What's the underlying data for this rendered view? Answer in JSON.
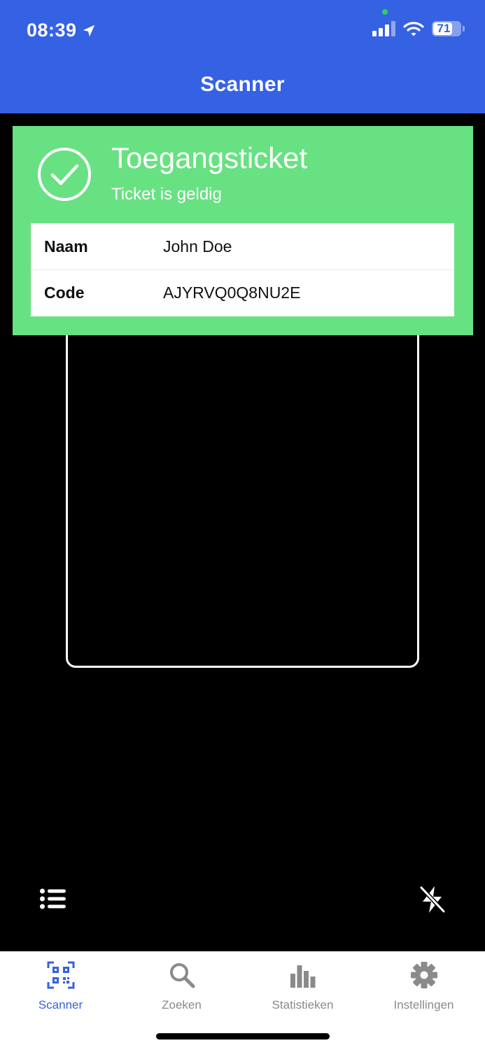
{
  "status_bar": {
    "time": "08:39",
    "battery": "71",
    "battery_level": 0.71
  },
  "nav": {
    "title": "Scanner"
  },
  "result": {
    "title": "Toegangsticket",
    "subtitle": "Ticket is geldig",
    "rows": [
      {
        "label": "Naam",
        "value": "John Doe"
      },
      {
        "label": "Code",
        "value": "AJYRVQ0Q8NU2E"
      }
    ]
  },
  "tabs": [
    {
      "label": "Scanner",
      "icon": "qr-code-icon",
      "active": true
    },
    {
      "label": "Zoeken",
      "icon": "search-icon",
      "active": false
    },
    {
      "label": "Statistieken",
      "icon": "bar-chart-icon",
      "active": false
    },
    {
      "label": "Instellingen",
      "icon": "gear-icon",
      "active": false
    }
  ],
  "colors": {
    "primary": "#3561E3",
    "success": "#68E182",
    "inactive": "#8a8a8a"
  }
}
